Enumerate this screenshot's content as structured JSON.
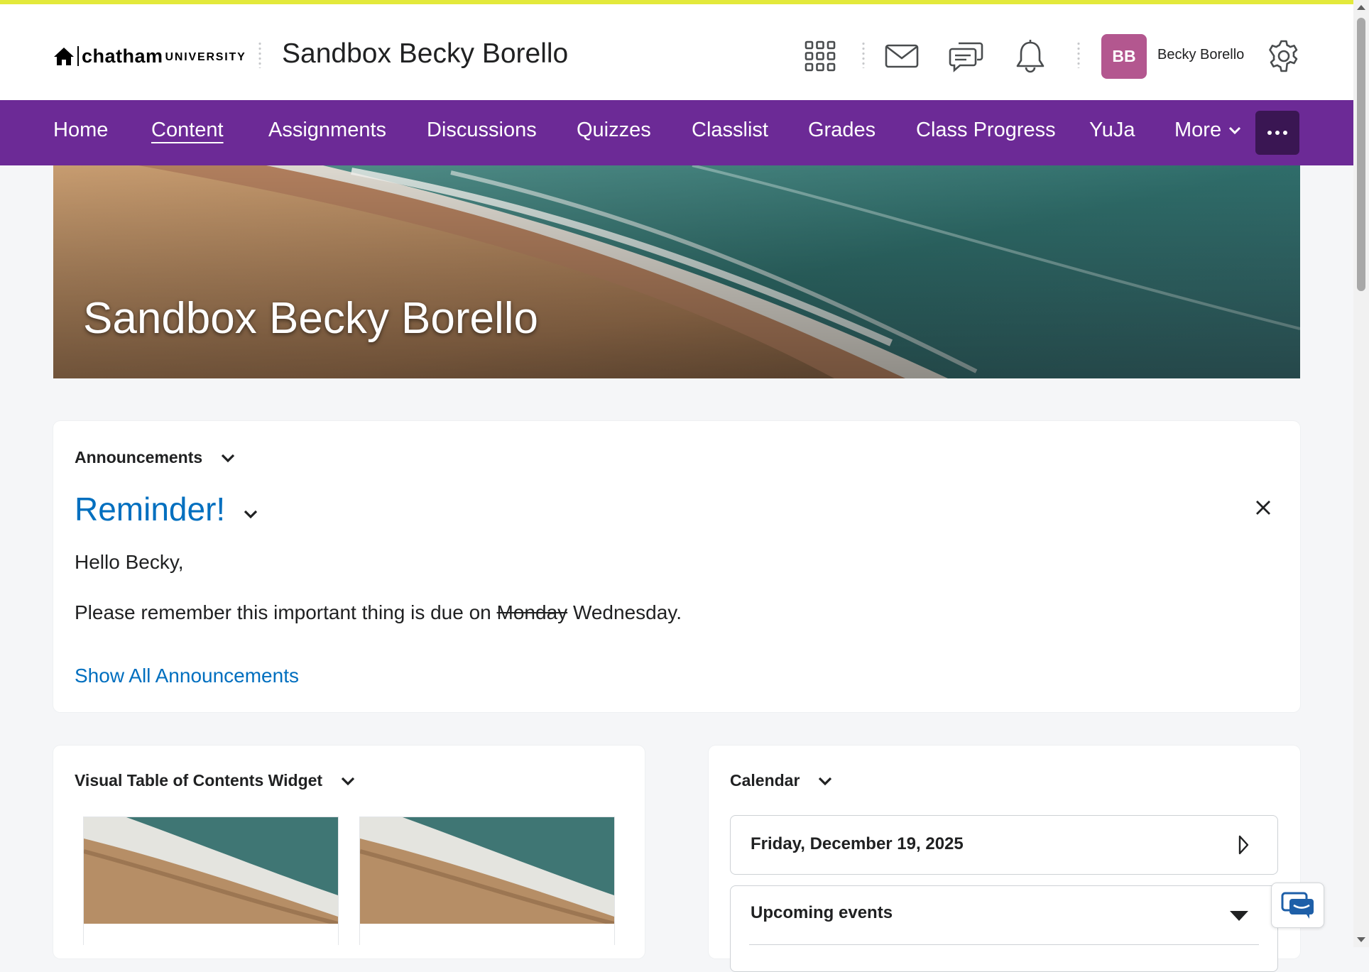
{
  "header": {
    "logo_main": "chatham",
    "logo_sub": "UNIVERSITY",
    "course_title": "Sandbox Becky Borello",
    "avatar_initials": "BB",
    "user_name": "Becky Borello",
    "icons": [
      "waffle-icon",
      "mail-icon",
      "chat-icon",
      "bell-icon",
      "gear-icon"
    ]
  },
  "nav": {
    "items": [
      "Home",
      "Content",
      "Assignments",
      "Discussions",
      "Quizzes",
      "Classlist",
      "Grades",
      "Class Progress",
      "YuJa"
    ],
    "active": "Content",
    "more_label": "More"
  },
  "banner": {
    "title": "Sandbox Becky Borello"
  },
  "announcements": {
    "heading": "Announcements",
    "item_title": "Reminder!",
    "greeting": "Hello Becky,",
    "body_before": "Please remember this important thing is due on",
    "body_struck": "Monday",
    "body_after": "Wednesday.",
    "show_all": "Show All Announcements"
  },
  "toc": {
    "heading": "Visual Table of Contents Widget"
  },
  "calendar": {
    "heading": "Calendar",
    "date": "Friday, December 19, 2025",
    "upcoming": "Upcoming events"
  },
  "colors": {
    "accent_bar": "#e3e93b",
    "nav_bg": "#6c2a96",
    "link": "#006fbf",
    "avatar": "#b3578f"
  }
}
